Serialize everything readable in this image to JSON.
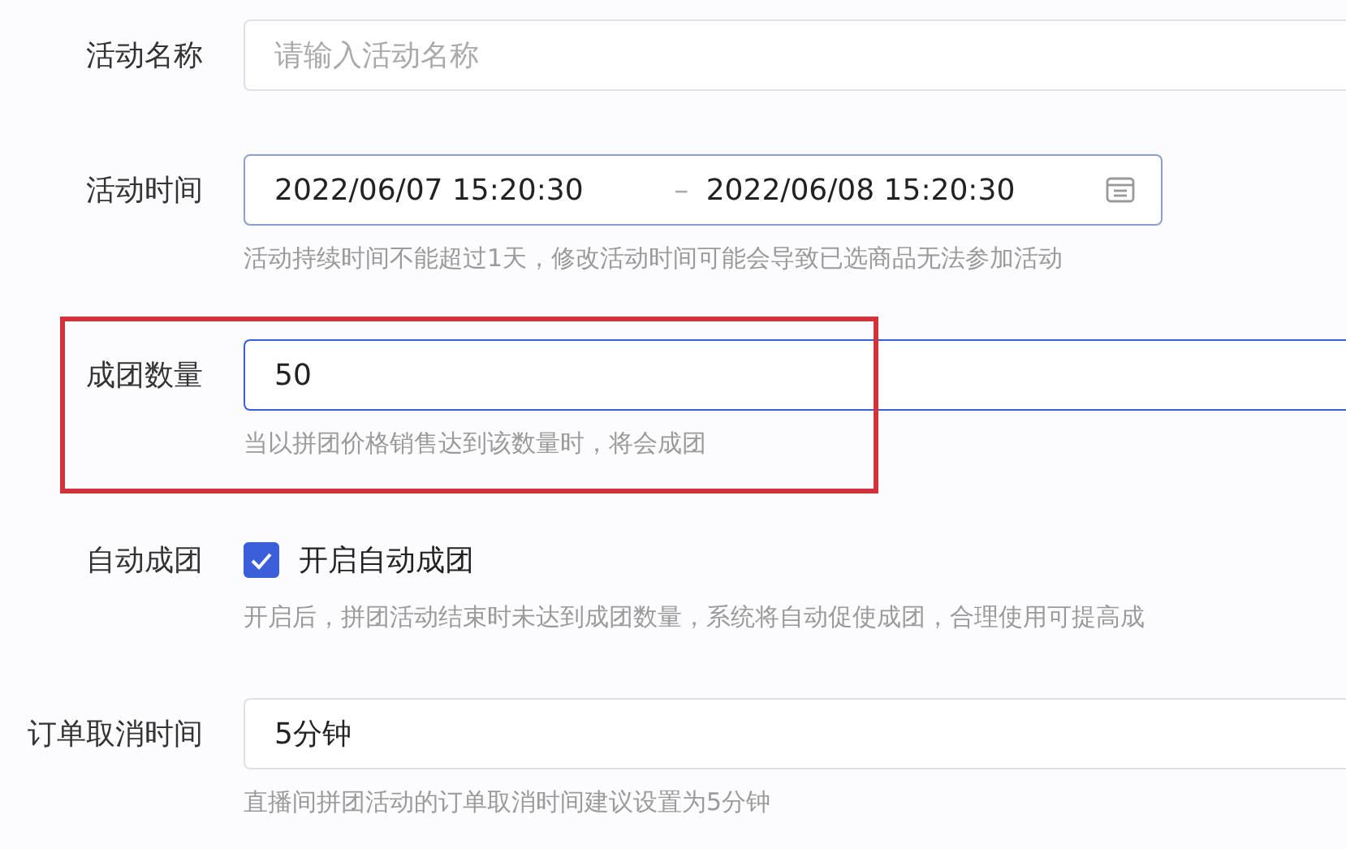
{
  "rows": [
    {
      "kind": "text",
      "label": "活动名称",
      "placeholder": "请输入活动名称"
    },
    {
      "kind": "daterange",
      "label": "活动时间",
      "start": "2022/06/07 15:20:30",
      "separator": "–",
      "end": "2022/06/08 15:20:30",
      "hint": "活动持续时间不能超过1天，修改活动时间可能会导致已选商品无法参加活动"
    },
    {
      "kind": "text",
      "label": "成团数量",
      "value": "50",
      "focused": true,
      "hint": "当以拼团价格销售达到该数量时，将会成团",
      "highlighted": true
    },
    {
      "kind": "checkbox",
      "label": "自动成团",
      "option": "开启自动成团",
      "checked": true,
      "hint": "开启后，拼团活动结束时未达到成团数量，系统将自动促使成团，合理使用可提高成"
    },
    {
      "kind": "text",
      "label": "订单取消时间",
      "value": "5分钟",
      "hint": "直播间拼团活动的订单取消时间建议设置为5分钟"
    }
  ]
}
